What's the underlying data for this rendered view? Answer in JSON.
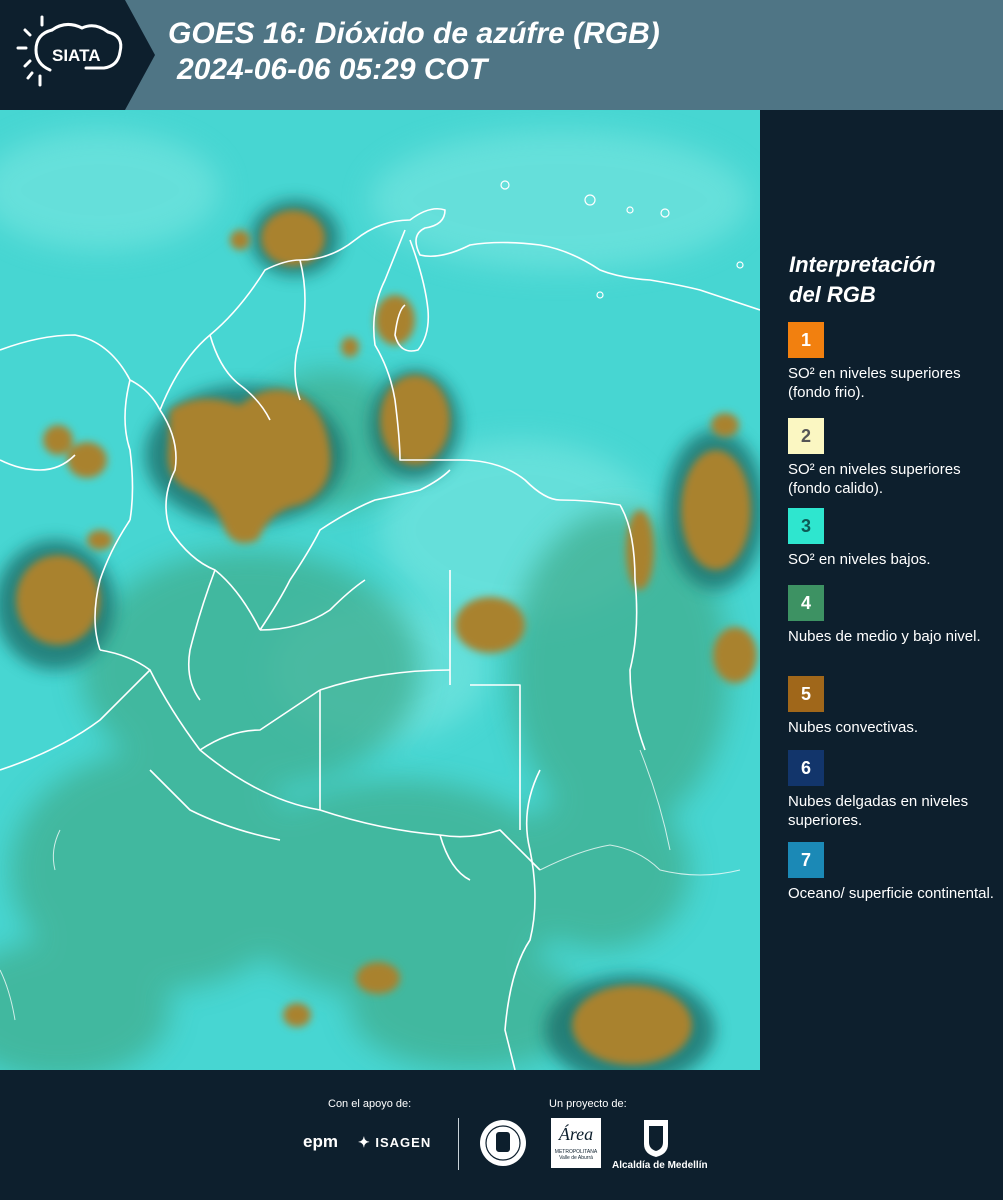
{
  "header": {
    "logo_text": "SIATA",
    "title_line1": "GOES 16: Dióxido de azúfre (RGB)",
    "title_line2": "2024-06-06 05:29 COT"
  },
  "legend": {
    "title_line1": "Interpretación",
    "title_line2": "del RGB",
    "items": [
      {
        "number": "1",
        "color": "#f2800f",
        "text": "SO² en niveles superiores (fondo frio)."
      },
      {
        "number": "2",
        "color": "#fbf7c2",
        "text": "SO² en niveles superiores (fondo calido)."
      },
      {
        "number": "3",
        "color": "#2ee6cf",
        "text": "SO² en niveles bajos."
      },
      {
        "number": "4",
        "color": "#3d9263",
        "text": "Nubes de medio y bajo nivel."
      },
      {
        "number": "5",
        "color": "#a0671a",
        "text": "Nubes convectivas."
      },
      {
        "number": "6",
        "color": "#12356b",
        "text": "Nubes delgadas en niveles superiores."
      },
      {
        "number": "7",
        "color": "#1b89b6",
        "text": "Oceano/ superficie continental."
      }
    ]
  },
  "footer": {
    "support_label": "Con el apoyo de:",
    "project_label": "Un proyecto de:",
    "sponsor_epm": "epm",
    "sponsor_isagen": "ISAGEN",
    "area_logo_text": "Área",
    "area_caption": "METROPOLITANA",
    "area_subcaption": "Valle de Aburrá",
    "alcaldia": "Alcaldía de Medellín"
  },
  "map": {
    "colors": {
      "base_cyan": "#47d6d2",
      "green_cloud": "#3fae8f",
      "convective": "#a9822f",
      "convective_dark": "#8a6a26",
      "border_line": "#ffffff"
    }
  }
}
